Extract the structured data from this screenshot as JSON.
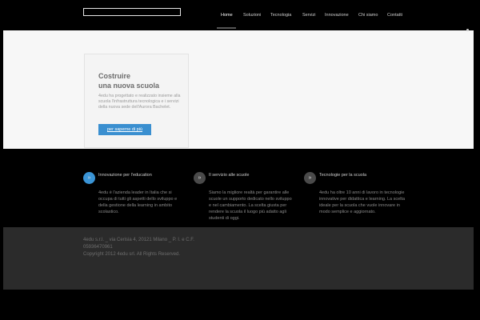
{
  "header": {
    "nav": [
      {
        "label": "Home",
        "active": true
      },
      {
        "label": "Soluzioni",
        "active": false
      },
      {
        "label": "Tecnologia",
        "active": false
      },
      {
        "label": "Servizi",
        "active": false
      },
      {
        "label": "Innovazione",
        "active": false
      },
      {
        "label": "Chi siamo",
        "active": false
      },
      {
        "label": "Contatti",
        "active": false
      }
    ]
  },
  "hero": {
    "title": "Costruire\nuna nuova scuola",
    "text": "4edu ha progettato e realizzato insieme alla scuola l'infrastruttura tecnologica e i servizi della nuova sede dell'Aurora Bachelet.",
    "button": "per saperne di più"
  },
  "features": [
    {
      "icon": "»",
      "title": "Innovazione per l'education",
      "text": "4edu è l'azienda leader in Italia che si occupa di tutti gli aspetti dello sviluppo e della gestione della learning in ambito scolastico."
    },
    {
      "icon": "»",
      "title": "Il servizio alle scuole",
      "text": "Siamo la migliore realtà per garantire alle scuole un supporto dedicato nello sviluppo e nel cambiamento. La scelta giusta per rendere la scuola il luogo più adatto agli studenti di oggi."
    },
    {
      "icon": "»",
      "title": "Tecnologie per la scuola",
      "text": "4edu ha oltre 10 anni di lavoro in tecnologie innovative per didattica e learning. La scelta ideale per la scuola che vuole innovare in modo semplice e aggiornato."
    }
  ],
  "footer": {
    "line1": "4edu s.r.l. _ via Cerisia 4, 20121 Milano _ P. I. e C.F.",
    "line2": "05936470961",
    "line3": "Copyright 2012 4edu srl. All Rights Reserved."
  },
  "colors": {
    "accent": "#3a8fd0",
    "background": "#000000",
    "hero_bg": "#f7f7f7",
    "footer_bg": "#2b2b2b"
  }
}
